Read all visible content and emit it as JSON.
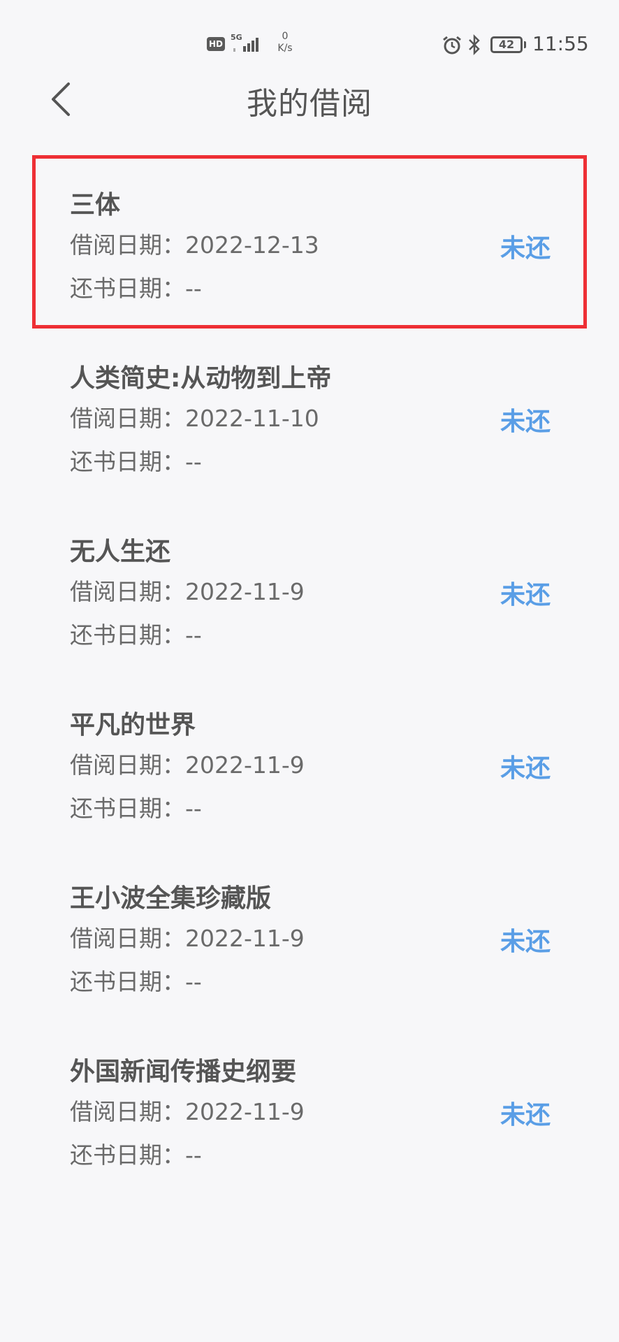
{
  "status_bar": {
    "hd": "HD",
    "network": "5G",
    "speed_value": "0",
    "speed_unit": "K/s",
    "battery": "42",
    "time": "11:55"
  },
  "header": {
    "title": "我的借阅"
  },
  "items": [
    {
      "book": "三体",
      "borrow_label": "借阅日期：",
      "borrow_date": "2022-12-13",
      "return_label": "还书日期：",
      "return_date": "--",
      "status": "未还"
    },
    {
      "book": "人类简史:从动物到上帝",
      "borrow_label": "借阅日期：",
      "borrow_date": "2022-11-10",
      "return_label": "还书日期：",
      "return_date": "--",
      "status": "未还"
    },
    {
      "book": "无人生还",
      "borrow_label": "借阅日期：",
      "borrow_date": "2022-11-9",
      "return_label": "还书日期：",
      "return_date": "--",
      "status": "未还"
    },
    {
      "book": "平凡的世界",
      "borrow_label": "借阅日期：",
      "borrow_date": "2022-11-9",
      "return_label": "还书日期：",
      "return_date": "--",
      "status": "未还"
    },
    {
      "book": "王小波全集珍藏版",
      "borrow_label": "借阅日期：",
      "borrow_date": "2022-11-9",
      "return_label": "还书日期：",
      "return_date": "--",
      "status": "未还"
    },
    {
      "book": "外国新闻传播史纲要",
      "borrow_label": "借阅日期：",
      "borrow_date": "2022-11-9",
      "return_label": "还书日期：",
      "return_date": "--",
      "status": "未还"
    }
  ],
  "colors": {
    "accent": "#5a9ee6",
    "highlight_border": "#ee2f35"
  }
}
